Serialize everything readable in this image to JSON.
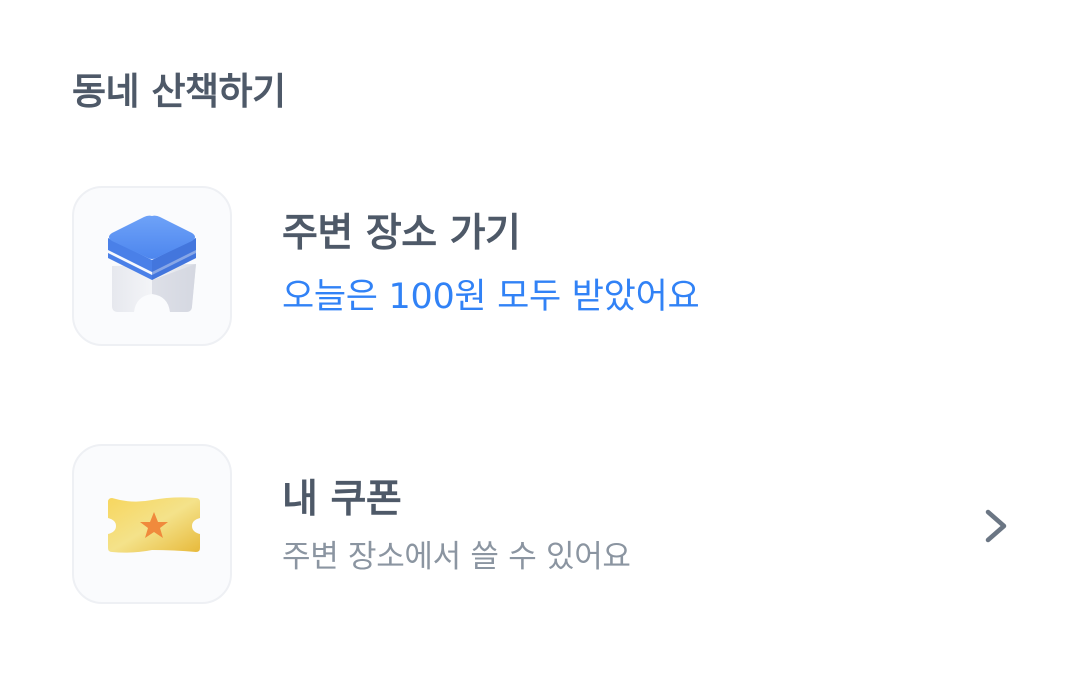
{
  "section": {
    "title": "동네 산책하기"
  },
  "items": [
    {
      "icon": "blue-block-icon",
      "title": "주변 장소 가기",
      "subtitle": "오늘은 100원 모두 받았어요",
      "subtitle_color": "#3182f6"
    },
    {
      "icon": "coupon-ticket-icon",
      "title": "내 쿠폰",
      "subtitle": "주변 장소에서 쓸 수 있어요",
      "subtitle_color": "#8b95a1",
      "trailing_icon": "chevron-right-icon"
    }
  ],
  "colors": {
    "title_text": "#4e5968",
    "accent_blue": "#3182f6",
    "muted_text": "#8b95a1",
    "coupon_gold": "#f2c94c",
    "star_orange": "#f08a3c"
  }
}
